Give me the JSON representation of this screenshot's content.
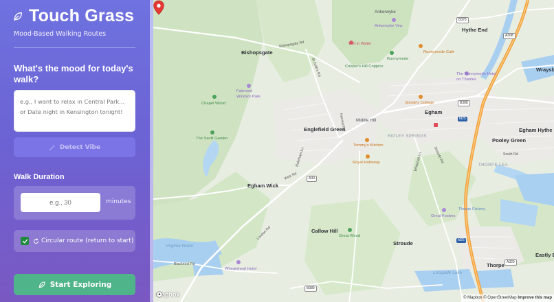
{
  "sidebar": {
    "title": "Touch Grass",
    "tagline": "Mood-Based Walking Routes",
    "mood_question": "What's the mood for today's walk?",
    "mood_placeholder": "e.g., I want to relax in Central Park... or Date night in Kensington tonight!",
    "detect_button": "Detect Vibe",
    "duration_label": "Walk Duration",
    "duration_placeholder": "e.g., 30",
    "duration_unit": "minutes",
    "circular_label": "Circular route (return to start)",
    "circular_checked": true,
    "explore_button": "Start Exploring"
  },
  "map": {
    "towns": [
      {
        "label": "Bishopsgate"
      },
      {
        "label": "Englefield Green"
      },
      {
        "label": "Egham Wick"
      },
      {
        "label": "Egham"
      },
      {
        "label": "Hythe End"
      },
      {
        "label": "Egham Hythe"
      },
      {
        "label": "Pooley Green"
      },
      {
        "label": "Callow Hill"
      },
      {
        "label": "Stroude"
      },
      {
        "label": "Thorpe"
      },
      {
        "label": "Eastly End"
      },
      {
        "label": "Wraysbury"
      }
    ],
    "areas": [
      {
        "label": "Ankerwyke"
      },
      {
        "label": "Middle Hill"
      },
      {
        "label": "RIPLEY SPRINGS"
      },
      {
        "label": "THORPE LEA"
      },
      {
        "label": "South Rd"
      }
    ],
    "pois": [
      {
        "label": "Ankerwyke Yew",
        "color": "purple"
      },
      {
        "label": "Writ in Water",
        "color": "red"
      },
      {
        "label": "Runnymede",
        "color": "green"
      },
      {
        "label": "Cooper's Hill Coppice",
        "color": "green"
      },
      {
        "label": "Runnymede Café",
        "color": "orange"
      },
      {
        "label": "The Runnymede Hotel on Thames",
        "color": "purple"
      },
      {
        "label": "Fairmont Windsor Park",
        "color": "purple"
      },
      {
        "label": "Chapel Wood",
        "color": "green"
      },
      {
        "label": "The Savill Garden",
        "color": "green"
      },
      {
        "label": "Strode's College",
        "color": "orange"
      },
      {
        "label": "Tommy's Kitchen",
        "color": "orange"
      },
      {
        "label": "Royal Holloway",
        "color": "orange"
      },
      {
        "label": "Great Wood",
        "color": "green"
      },
      {
        "label": "Great Fosters",
        "color": "purple"
      },
      {
        "label": "Thorpe Fishery",
        "color": "blue"
      },
      {
        "label": "Wheatsheaf Hotel",
        "color": "purple"
      },
      {
        "label": "Virginia Water",
        "color": "water"
      },
      {
        "label": "Longside Lake",
        "color": "water"
      }
    ],
    "roads": [
      {
        "label": "Bishopsgate Rd"
      },
      {
        "label": "St Jude's Rd"
      },
      {
        "label": "Harvest Rd"
      },
      {
        "label": "Bakeham Ln"
      },
      {
        "label": "Wick Rd"
      },
      {
        "label": "Whitehall Ln"
      },
      {
        "label": "Stroude Rd"
      },
      {
        "label": "London Rd"
      },
      {
        "label": "Blacknest Rd"
      }
    ],
    "shields": [
      {
        "label": "B376",
        "type": "white"
      },
      {
        "label": "A308",
        "type": "white"
      },
      {
        "label": "B388",
        "type": "white"
      },
      {
        "label": "A30",
        "type": "white"
      },
      {
        "label": "M25",
        "type": "blue"
      },
      {
        "label": "B389",
        "type": "white"
      },
      {
        "label": "A329",
        "type": "white"
      }
    ],
    "logo": "mapbox",
    "attribution": "© Mapbox © OpenStreetMap",
    "improve": "Improve this map"
  },
  "colors": {
    "sidebar_top": "#6f72e0",
    "sidebar_bottom": "#7a58c2",
    "explore_button": "#4fb48a",
    "detect_button": "#7b74e6",
    "pin": "#e53935"
  },
  "icons": {
    "brand": "leaf-icon",
    "detect": "sparkle-icon",
    "circular": "refresh-icon",
    "explore": "leaf-icon",
    "marker": "map-pin-icon"
  }
}
